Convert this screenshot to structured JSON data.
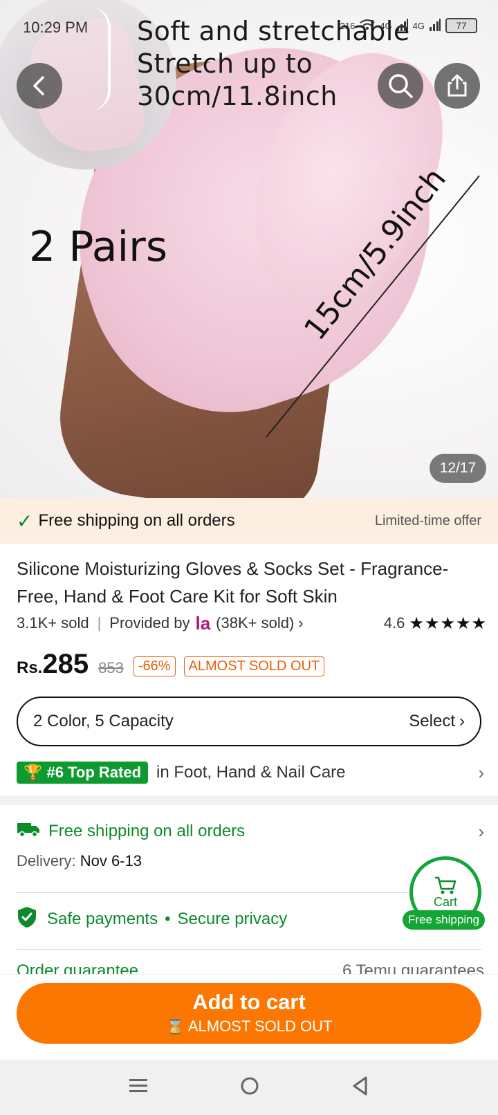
{
  "status_bar": {
    "time": "10:29 PM",
    "data_speed": "216",
    "network_1": "4G",
    "network_2": "4G",
    "battery": "77"
  },
  "hero": {
    "text_line1": "Soft and stretchable",
    "text_line2": "Stretch up to 30cm/11.8inch",
    "pairs_label": "2 Pairs",
    "measure_label": "15cm/5.9inch",
    "counter": "12/17"
  },
  "icons": {
    "back": "back-arrow-icon",
    "search": "search-icon",
    "share": "share-icon"
  },
  "banner": {
    "text": "Free shipping on all orders",
    "offer": "Limited-time offer"
  },
  "product": {
    "title": "Silicone Moisturizing Gloves & Socks Set - Fragrance-Free, Hand & Foot Care Kit for Soft Skin",
    "sold": "3.1K+ sold",
    "provided_by": "Provided by",
    "seller_logo": "la",
    "seller_sold": "(38K+ sold)",
    "rating": "4.6",
    "stars": "★★★★★"
  },
  "price": {
    "currency": "Rs.",
    "amount": "285",
    "original": "853",
    "discount": "-66%",
    "stock_tag": "ALMOST SOLD OUT"
  },
  "variant": {
    "text": "2 Color, 5 Capacity",
    "select": "Select"
  },
  "rank": {
    "badge": "#6 Top Rated",
    "category": "in Foot, Hand & Nail Care"
  },
  "shipping": {
    "title": "Free shipping on all orders",
    "delivery_label": "Delivery:",
    "delivery_value": "Nov 6-13"
  },
  "safety": {
    "payments": "Safe payments",
    "privacy": "Secure privacy"
  },
  "guarantee": {
    "left": "Order guarantee",
    "right": "6 Temu guarantees"
  },
  "cart_float": {
    "label": "Cart",
    "pill": "Free shipping"
  },
  "cta": {
    "main": "Add to cart",
    "sub": "ALMOST SOLD OUT"
  },
  "colors": {
    "accent_orange": "#fb7701",
    "green": "#0d8a2c",
    "banner_bg": "#fdeee2"
  }
}
